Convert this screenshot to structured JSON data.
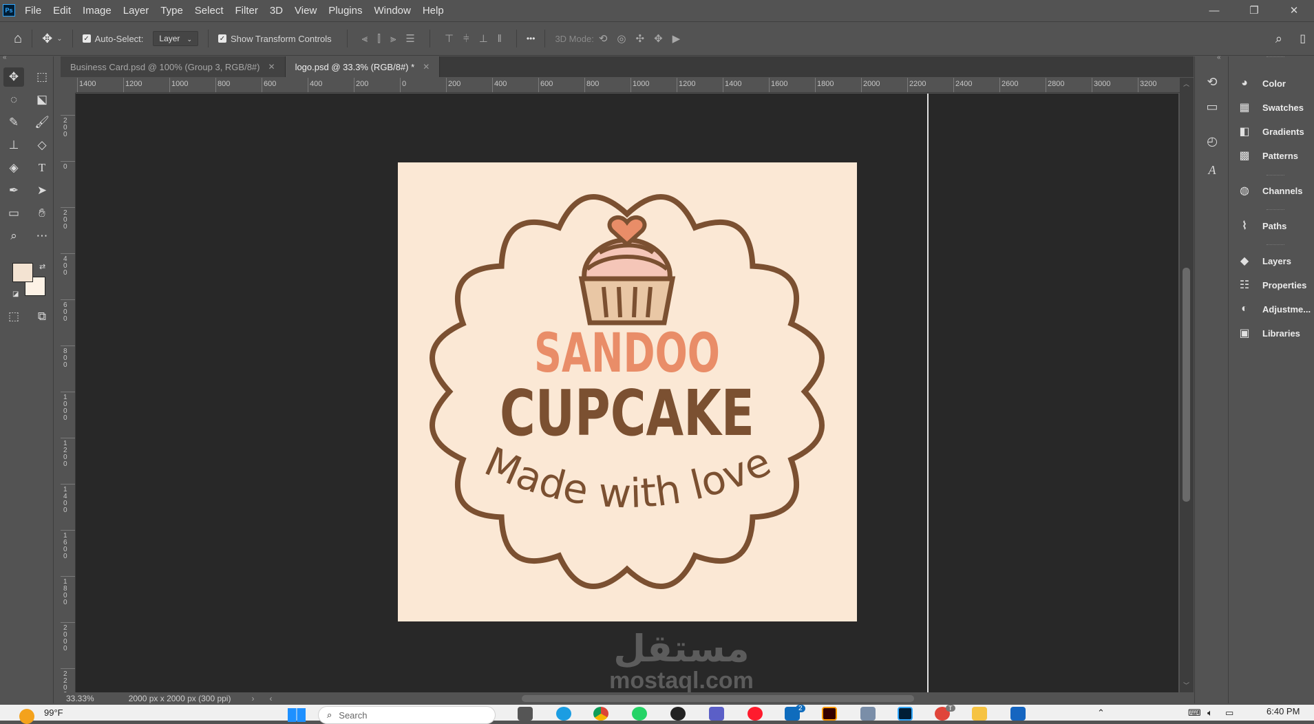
{
  "app": {
    "logo": "Ps"
  },
  "menu": [
    "File",
    "Edit",
    "Image",
    "Layer",
    "Type",
    "Select",
    "Filter",
    "3D",
    "View",
    "Plugins",
    "Window",
    "Help"
  ],
  "window_controls": {
    "minimize": "—",
    "restore": "❐",
    "close": "✕"
  },
  "options": {
    "auto_select_label": "Auto-Select:",
    "auto_select_value": "Layer",
    "transform_label": "Show Transform Controls",
    "mode_3d_label": "3D Mode:",
    "more": "•••"
  },
  "tabs": [
    {
      "label": "Business Card.psd @ 100% (Group 3, RGB/8#)",
      "close": "✕"
    },
    {
      "label": "logo.psd @ 33.3% (RGB/8#) *",
      "close": "✕"
    }
  ],
  "ruler_h": [
    "1400",
    "1200",
    "1000",
    "800",
    "600",
    "400",
    "200",
    "0",
    "200",
    "400",
    "600",
    "800",
    "1000",
    "1200",
    "1400",
    "1600",
    "1800",
    "2000",
    "2200",
    "2400",
    "2600",
    "2800",
    "3000",
    "3200"
  ],
  "ruler_v": [
    "200",
    "0",
    "200",
    "400",
    "600",
    "800",
    "1000",
    "1200",
    "1400",
    "1600",
    "1800",
    "2000",
    "2200"
  ],
  "artwork": {
    "line1": "SANDOO",
    "line2": "CUPCAKE",
    "line3": "Made with love",
    "bg": "#fbe8d5",
    "brown": "#7b5031",
    "peach": "#e98d68"
  },
  "watermark": {
    "arabic": "مستقل",
    "latin": "mostaql.com"
  },
  "status": {
    "zoom": "33.33%",
    "doc_size": "2000 px x 2000 px (300 ppi)"
  },
  "panels": [
    {
      "label": "Color",
      "icon": "palette-icon"
    },
    {
      "label": "Swatches",
      "icon": "swatches-icon"
    },
    {
      "label": "Gradients",
      "icon": "gradients-icon"
    },
    {
      "label": "Patterns",
      "icon": "patterns-icon"
    },
    {
      "label": "Channels",
      "icon": "channels-icon"
    },
    {
      "label": "Paths",
      "icon": "paths-icon"
    },
    {
      "label": "Layers",
      "icon": "layers-icon"
    },
    {
      "label": "Properties",
      "icon": "properties-icon"
    },
    {
      "label": "Adjustme...",
      "icon": "adjustments-icon"
    },
    {
      "label": "Libraries",
      "icon": "libraries-icon"
    }
  ],
  "taskbar": {
    "weather": "99°F",
    "search": "Search",
    "clock": "6:40 PM",
    "badge_1": "2",
    "badge_2": "T"
  },
  "colors": {
    "foreground": "#f3e3d2",
    "background": "#fdf2e6"
  }
}
